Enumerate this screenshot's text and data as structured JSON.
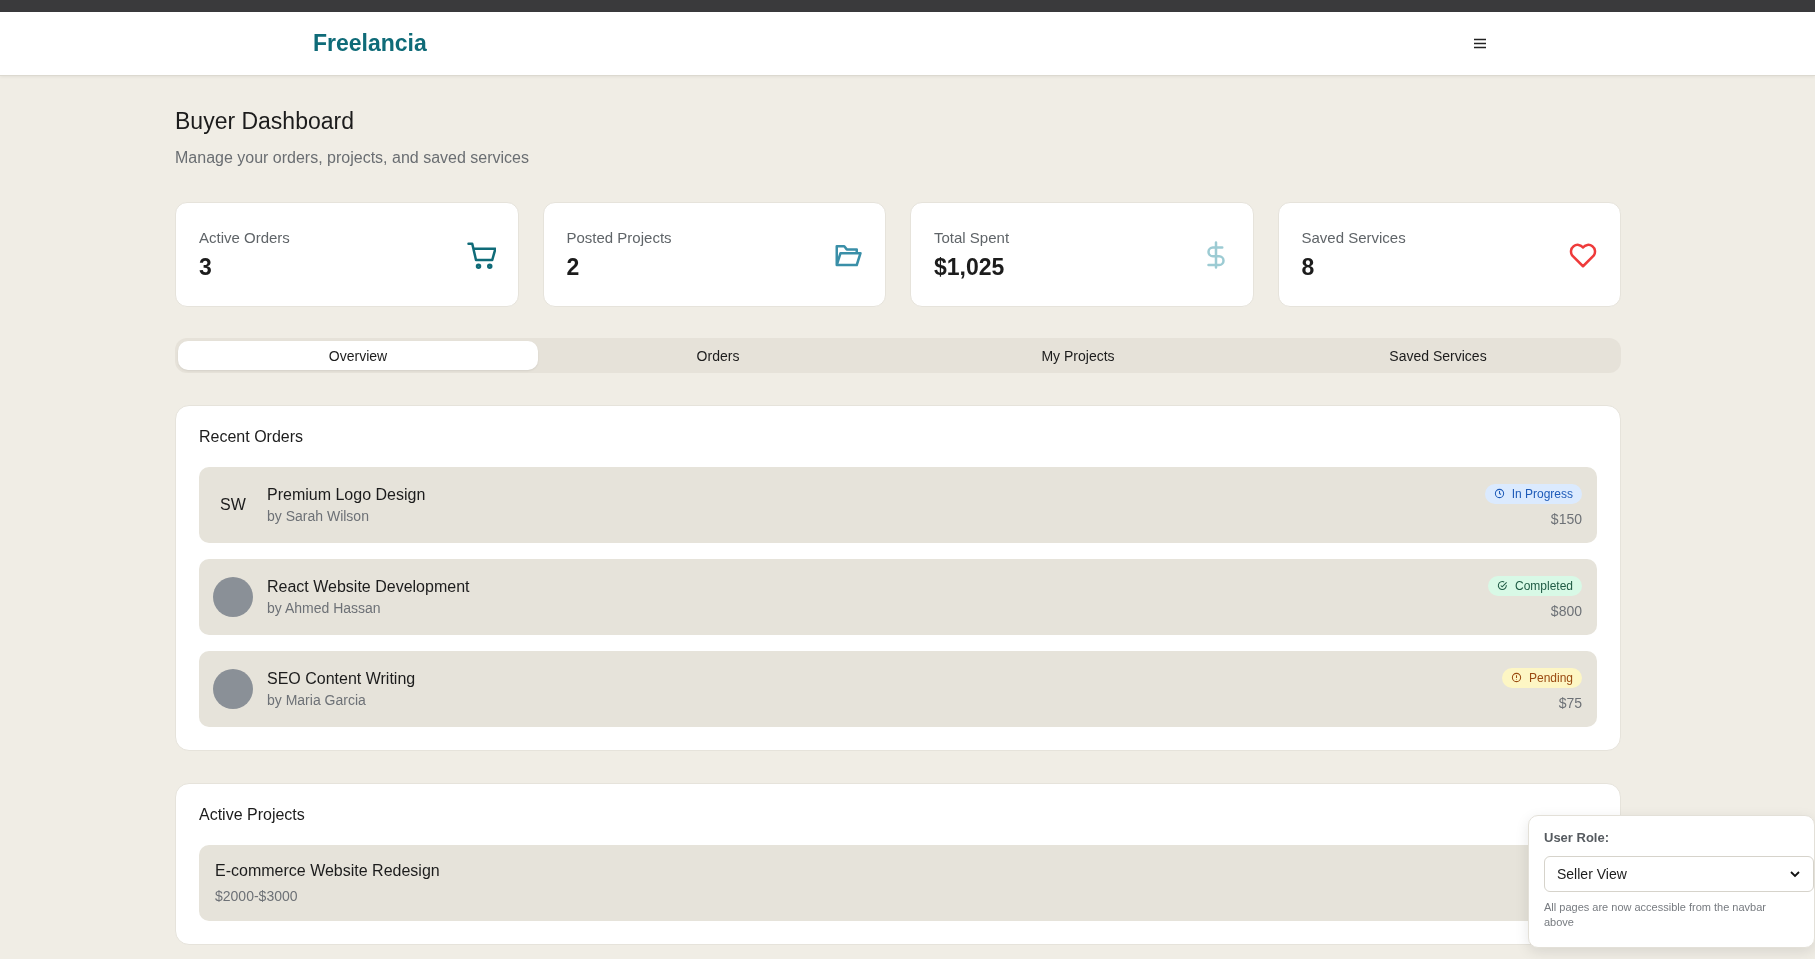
{
  "navbar": {
    "logo": "Freelancia"
  },
  "header": {
    "title": "Buyer Dashboard",
    "subtitle": "Manage your orders, projects, and saved services"
  },
  "stats": [
    {
      "label": "Active Orders",
      "value": "3",
      "kind": "cart"
    },
    {
      "label": "Posted Projects",
      "value": "2",
      "kind": "folder"
    },
    {
      "label": "Total Spent",
      "value": "$1,025",
      "kind": "dollar"
    },
    {
      "label": "Saved Services",
      "value": "8",
      "kind": "heart"
    }
  ],
  "tabs": [
    {
      "label": "Overview",
      "selected": true
    },
    {
      "label": "Orders",
      "selected": false
    },
    {
      "label": "My Projects",
      "selected": false
    },
    {
      "label": "Saved Services",
      "selected": false
    }
  ],
  "recent_orders": {
    "title": "Recent Orders",
    "items": [
      {
        "avatar": {
          "kind": "initials",
          "text": "SW"
        },
        "title": "Premium Logo Design",
        "seller": "by Sarah Wilson",
        "status": {
          "kind": "in_progress",
          "label": "In Progress"
        },
        "price": "$150"
      },
      {
        "avatar": {
          "kind": "photo"
        },
        "title": "React Website Development",
        "seller": "by Ahmed Hassan",
        "status": {
          "kind": "completed",
          "label": "Completed"
        },
        "price": "$800"
      },
      {
        "avatar": {
          "kind": "photo"
        },
        "title": "SEO Content Writing",
        "seller": "by Maria Garcia",
        "status": {
          "kind": "pending",
          "label": "Pending"
        },
        "price": "$75"
      }
    ]
  },
  "active_projects": {
    "title": "Active Projects",
    "items": [
      {
        "title": "E-commerce Website Redesign",
        "budget": "$2000-$3000"
      }
    ]
  },
  "role_panel": {
    "label": "User Role:",
    "value": "Seller View",
    "note": "All pages are now accessible from the navbar above"
  }
}
